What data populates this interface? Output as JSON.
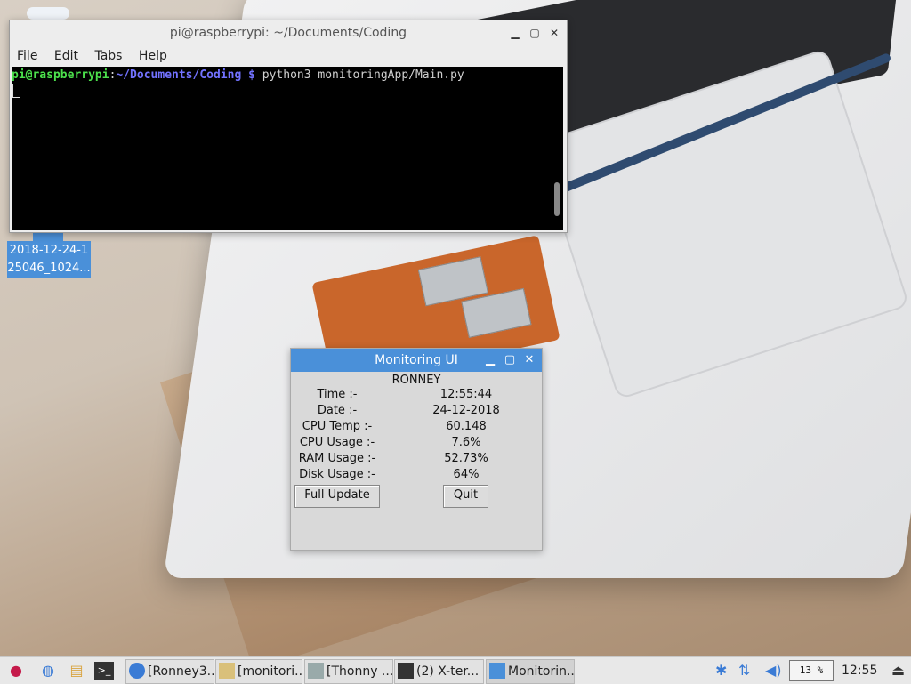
{
  "terminal": {
    "title": "pi@raspberrypi: ~/Documents/Coding",
    "menu": [
      "File",
      "Edit",
      "Tabs",
      "Help"
    ],
    "prompt_user": "pi@raspberrypi",
    "prompt_sep": ":",
    "prompt_path": "~/Documents/Coding $",
    "command": " python3 monitoringApp/Main.py"
  },
  "desktop": {
    "file_label_line1": "2018-12-24-1",
    "file_label_line2": "25046_1024..."
  },
  "monitor": {
    "title": "Monitoring UI",
    "name": "RONNEY",
    "rows": [
      {
        "label": "Time :-",
        "value": "12:55:44"
      },
      {
        "label": "Date :-",
        "value": "24-12-2018"
      },
      {
        "label": "CPU Temp :-",
        "value": "60.148"
      },
      {
        "label": "CPU Usage :-",
        "value": "7.6%"
      },
      {
        "label": "RAM Usage :-",
        "value": "52.73%"
      },
      {
        "label": "Disk Usage :-",
        "value": "64%"
      }
    ],
    "full_update_label": "Full Update",
    "quit_label": "Quit"
  },
  "taskbar": {
    "tasks": [
      "[Ronney3...",
      "[monitori...",
      "[Thonny ...",
      "(2) X-ter...",
      "Monitorin..."
    ],
    "cpu_usage": "13 %",
    "clock": "12:55"
  },
  "window_controls": {
    "minimize": "▁",
    "maximize": "▢",
    "close": "✕"
  }
}
